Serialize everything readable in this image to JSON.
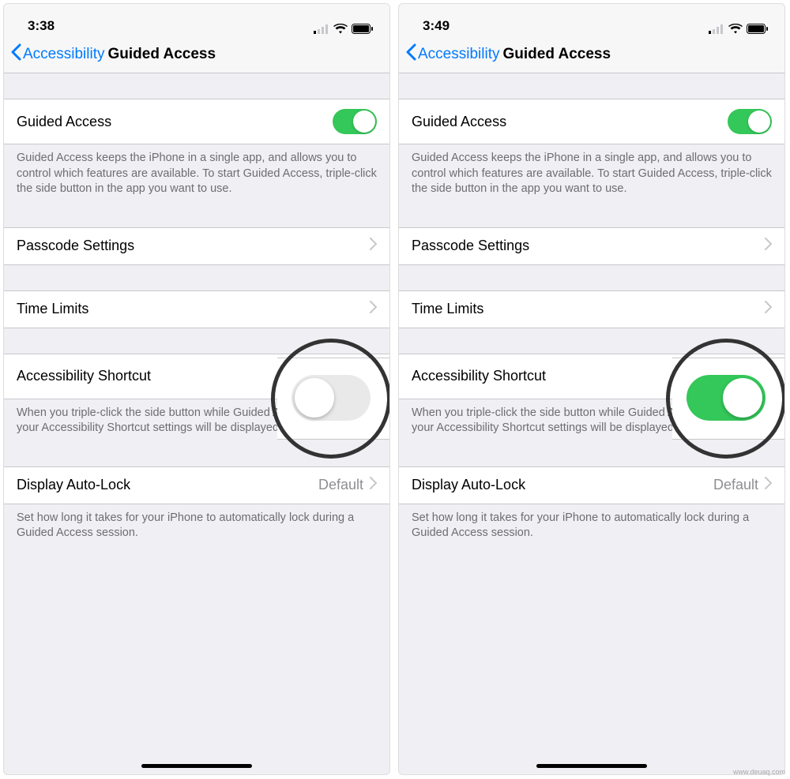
{
  "watermark": "www.deuaq.com",
  "screens": [
    {
      "time": "3:38",
      "back_label": "Accessibility",
      "title": "Guided Access",
      "guided_access": {
        "label": "Guided Access",
        "on": true
      },
      "guided_access_footer": "Guided Access keeps the iPhone in a single app, and allows you to control which features are available. To start Guided Access, triple-click the side button in the app you want to use.",
      "passcode": {
        "label": "Passcode Settings"
      },
      "time_limits": {
        "label": "Time Limits"
      },
      "shortcut": {
        "label": "Accessibility Shortcut",
        "on": false
      },
      "shortcut_footer": "When you triple-click the side button while Guided Access is enabled, your Accessibility Shortcut settings will be displayed.",
      "autolock": {
        "label": "Display Auto-Lock",
        "value": "Default"
      },
      "autolock_footer": "Set how long it takes for your iPhone to automatically lock during a Guided Access session."
    },
    {
      "time": "3:49",
      "back_label": "Accessibility",
      "title": "Guided Access",
      "guided_access": {
        "label": "Guided Access",
        "on": true
      },
      "guided_access_footer": "Guided Access keeps the iPhone in a single app, and allows you to control which features are available. To start Guided Access, triple-click the side button in the app you want to use.",
      "passcode": {
        "label": "Passcode Settings"
      },
      "time_limits": {
        "label": "Time Limits"
      },
      "shortcut": {
        "label": "Accessibility Shortcut",
        "on": true
      },
      "shortcut_footer": "When you triple-click the side button while Guided Access is enabled, your Accessibility Shortcut settings will be displayed.",
      "autolock": {
        "label": "Display Auto-Lock",
        "value": "Default"
      },
      "autolock_footer": "Set how long it takes for your iPhone to automatically lock during a Guided Access session."
    }
  ]
}
